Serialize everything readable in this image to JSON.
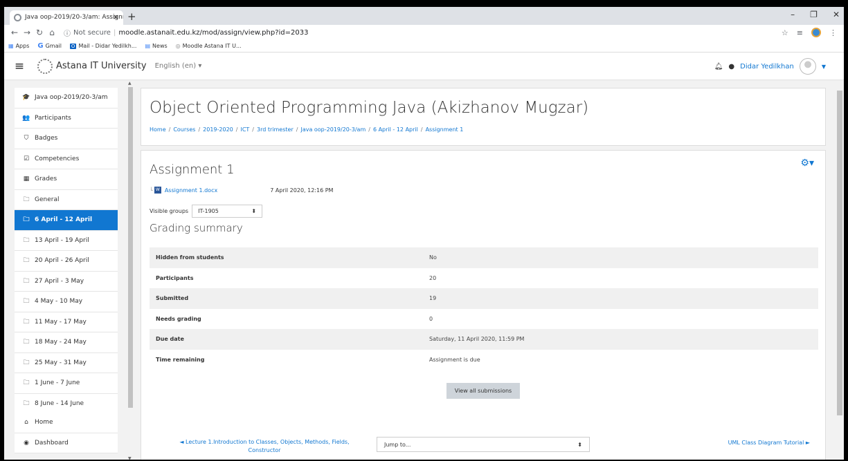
{
  "browser": {
    "tab_title": "Java oop-2019/20-3/am: Assignm",
    "tab_close": "×",
    "new_tab": "+",
    "security": "Not secure",
    "url": "moodle.astanait.edu.kz/mod/assign/view.php?id=2033",
    "bookmarks": [
      "Apps",
      "Gmail",
      "Mail - Didar Yedilkh...",
      "News",
      "Moodle Astana IT U..."
    ]
  },
  "navbar": {
    "site_name": "Astana IT University",
    "language": "English (en) ▾",
    "user_name": "Didar Yedilkhan"
  },
  "drawer": {
    "course_items": [
      {
        "icon": "graduation-cap-icon",
        "glyph": "🎓",
        "label": "Java oop-2019/20-3/am"
      },
      {
        "icon": "users-icon",
        "glyph": "👥",
        "label": "Participants"
      },
      {
        "icon": "shield-icon",
        "glyph": "⛉",
        "label": "Badges"
      },
      {
        "icon": "checkbox-icon",
        "glyph": "☑",
        "label": "Competencies"
      },
      {
        "icon": "table-icon",
        "glyph": "▦",
        "label": "Grades"
      },
      {
        "icon": "folder-icon",
        "glyph": "🗀",
        "label": "General"
      },
      {
        "icon": "folder-icon",
        "glyph": "🗀",
        "label": "6 April - 12 April",
        "active": true
      },
      {
        "icon": "folder-icon",
        "glyph": "🗀",
        "label": "13 April - 19 April"
      },
      {
        "icon": "folder-icon",
        "glyph": "🗀",
        "label": "20 April - 26 April"
      },
      {
        "icon": "folder-icon",
        "glyph": "🗀",
        "label": "27 April - 3 May"
      },
      {
        "icon": "folder-icon",
        "glyph": "🗀",
        "label": "4 May - 10 May"
      },
      {
        "icon": "folder-icon",
        "glyph": "🗀",
        "label": "11 May - 17 May"
      },
      {
        "icon": "folder-icon",
        "glyph": "🗀",
        "label": "18 May - 24 May"
      },
      {
        "icon": "folder-icon",
        "glyph": "🗀",
        "label": "25 May - 31 May"
      },
      {
        "icon": "folder-icon",
        "glyph": "🗀",
        "label": "1 June - 7 June"
      },
      {
        "icon": "folder-icon",
        "glyph": "🗀",
        "label": "8 June - 14 June"
      }
    ],
    "site_items": [
      {
        "icon": "home-icon",
        "glyph": "⌂",
        "label": "Home"
      },
      {
        "icon": "dashboard-icon",
        "glyph": "◉",
        "label": "Dashboard"
      }
    ]
  },
  "header": {
    "title": "Object Oriented Programming Java (Akizhanov Mugzar)",
    "breadcrumb": [
      "Home",
      "Courses",
      "2019-2020",
      "ICT",
      "3rd trimester",
      "Java oop-2019/20-3/am",
      "6 April - 12 April",
      "Assignment 1"
    ]
  },
  "assignment": {
    "title": "Assignment 1",
    "file_name": "Assignment 1.docx",
    "file_date": "7 April 2020, 12:16 PM",
    "groups_label": "Visible groups",
    "groups_value": "IT-1905",
    "grading_title": "Grading summary",
    "summary": [
      {
        "label": "Hidden from students",
        "value": "No"
      },
      {
        "label": "Participants",
        "value": "20"
      },
      {
        "label": "Submitted",
        "value": "19"
      },
      {
        "label": "Needs grading",
        "value": "0"
      },
      {
        "label": "Due date",
        "value": "Saturday, 11 April 2020, 11:59 PM"
      },
      {
        "label": "Time remaining",
        "value": "Assignment is due"
      }
    ],
    "view_button": "View all submissions",
    "prev_link": "◄ Lecture 1.Introduction to Classes, Objects, Methods, Fields, Constructor",
    "jump_placeholder": "Jump to...",
    "next_link": "UML Class Diagram Tutorial ►"
  },
  "colors": {
    "accent": "#1177d1",
    "active_bg": "#1177d1",
    "page_bg": "#f2f2f2"
  }
}
